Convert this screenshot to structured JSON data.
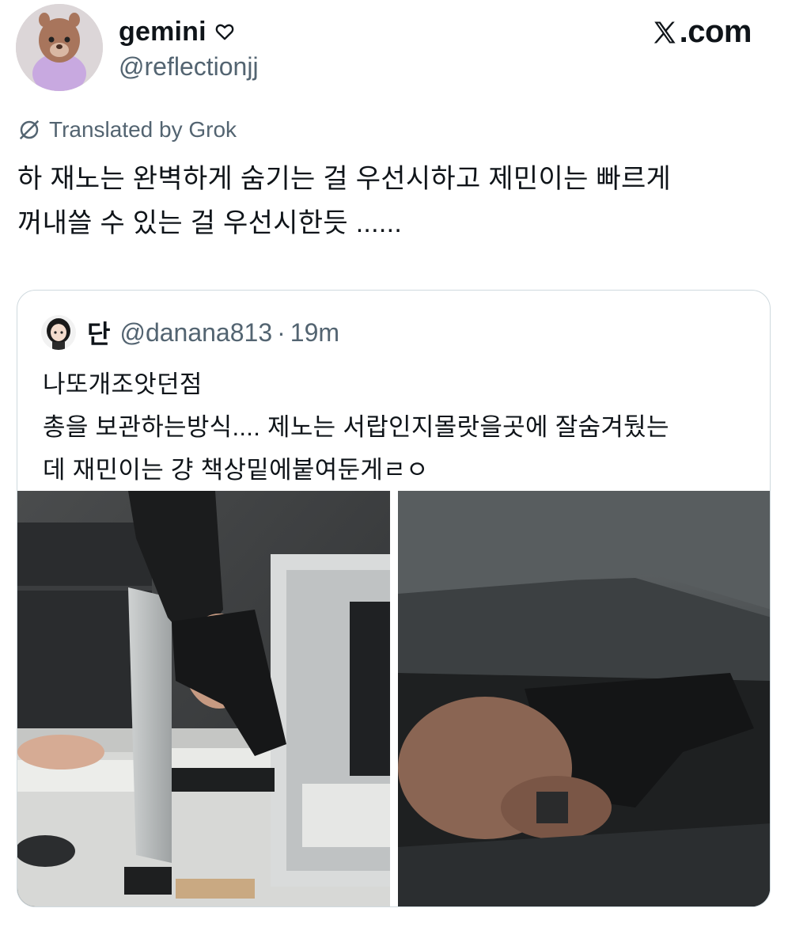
{
  "author": {
    "display_name": "gemini",
    "handle": "@reflectionjj",
    "badge_icon": "heart-outline-icon"
  },
  "brand": {
    "logo_icon": "x-logo-icon",
    "label": ".com"
  },
  "translation": {
    "icon": "grok-icon",
    "label": "Translated by Grok"
  },
  "tweet": {
    "line1": "하 재노는 완벽하게 숨기는 걸 우선시하고 제민이는 빠르게",
    "line2": "꺼내쓸 수 있는 걸 우선시한듯 ......"
  },
  "quote": {
    "display_name": "단",
    "handle": "@danana813",
    "separator": "·",
    "time": "19m",
    "text_line1": "나또개조앗던점",
    "text_line2": "총을 보관하는방식.... 제노는 서랍인지몰랏을곳에 잘숨겨뒀는",
    "text_line3": "데 재민이는 걍 책상밑에붙여둔게ㄹㅇ"
  },
  "colors": {
    "text_primary": "#0f1419",
    "text_secondary": "#536471",
    "border": "#cfd9de"
  }
}
